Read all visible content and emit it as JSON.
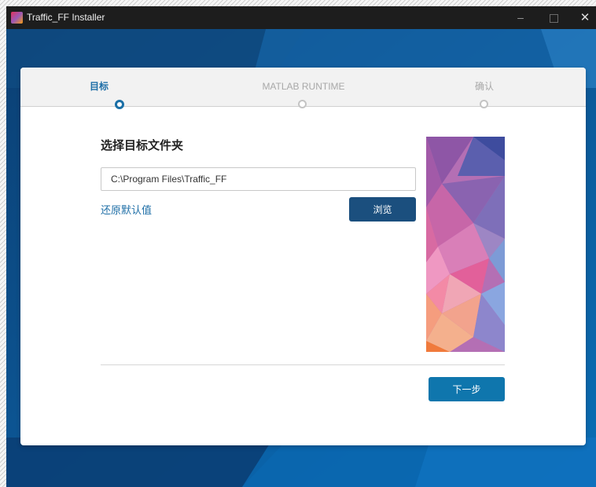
{
  "window": {
    "title": "Traffic_FF Installer",
    "controls": {
      "minimize": "–",
      "close": "✕"
    }
  },
  "steps": [
    {
      "label": "目标",
      "state": "active"
    },
    {
      "label": "MATLAB RUNTIME",
      "state": "pending"
    },
    {
      "label": "确认",
      "state": "pending"
    }
  ],
  "content": {
    "section_title": "选择目标文件夹",
    "install_path": "C:\\Program Files\\Traffic_FF",
    "restore_default_label": "还原默认值",
    "browse_label": "浏览"
  },
  "footer": {
    "next_label": "下一步"
  },
  "colors": {
    "accent": "#1f6fa7",
    "browse_button": "#1b4f7e",
    "next_button": "#0f76ad",
    "background": "#0a4f86",
    "titlebar": "#1d1d1d"
  },
  "icons": {
    "app": "app-icon",
    "minimize": "minimize-icon",
    "maximize": "maximize-icon",
    "close": "close-icon"
  }
}
